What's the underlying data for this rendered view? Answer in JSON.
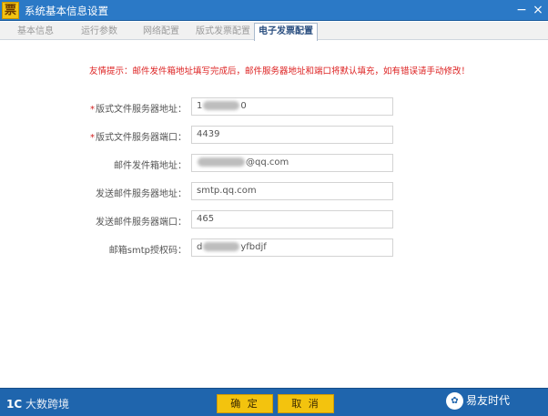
{
  "window": {
    "logo_char": "票",
    "title": "系统基本信息设置",
    "minimize_glyph": "−",
    "close_glyph": "×"
  },
  "tabs": [
    {
      "label": "基本信息",
      "active": false
    },
    {
      "label": "运行参数",
      "active": false
    },
    {
      "label": "网络配置",
      "active": false
    },
    {
      "label": "版式发票配置",
      "active": false
    },
    {
      "label": "电子发票配置",
      "active": true
    }
  ],
  "notice": "友情提示：邮件发件箱地址填写完成后，邮件服务器地址和端口将默认填充，如有错误请手动修改！",
  "form": {
    "fields": [
      {
        "label": "版式文件服务器地址：",
        "required": true,
        "prefix": "1",
        "suffix": "0"
      },
      {
        "label": "版式文件服务器端口：",
        "required": true,
        "prefix": "4439",
        "suffix": ""
      },
      {
        "label": "邮件发件箱地址：",
        "required": false,
        "prefix": "",
        "suffix": "@qq.com"
      },
      {
        "label": "发送邮件服务器地址：",
        "required": false,
        "prefix": "smtp.qq.com",
        "suffix": ""
      },
      {
        "label": "发送邮件服务器端口：",
        "required": false,
        "prefix": "465",
        "suffix": ""
      },
      {
        "label": "邮箱smtp授权码：",
        "required": false,
        "prefix": "d",
        "suffix": "yfbdjf"
      }
    ]
  },
  "footer": {
    "brand_mark": "1C",
    "brand_name": "大数跨境",
    "confirm_label": "确 定",
    "cancel_label": "取 消",
    "watermark_icon": "✿",
    "watermark_text": "易友时代"
  },
  "colors": {
    "title_bar": "#2b79c6",
    "footer_bar": "#1f65ad",
    "button": "#f3c30e",
    "notice": "#dd2222"
  }
}
